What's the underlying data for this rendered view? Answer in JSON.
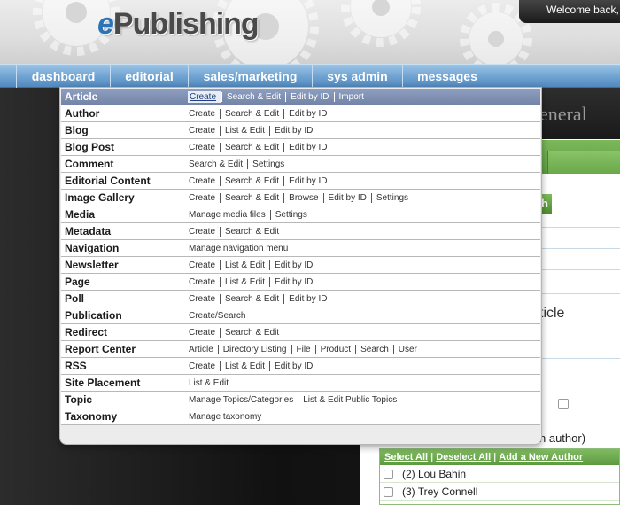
{
  "header": {
    "logo_prefix": "e",
    "logo_text": "Publishing",
    "welcome": "Welcome back,"
  },
  "nav": {
    "tabs": [
      "dashboard",
      "editorial",
      "sales/marketing",
      "sys admin",
      "messages"
    ]
  },
  "background_page": {
    "title_fragment": "eneral",
    "search_button_fragment": "h",
    "article_fragment": "ticle",
    "author_note_fragment": "n author)",
    "author_toolbar": {
      "select_all": "Select All",
      "deselect_all": "Deselect All",
      "add_author": "Add a New Author",
      "separator": "|"
    },
    "authors": [
      "(2) Lou Bahin",
      "(3) Trey Connell"
    ]
  },
  "menu": {
    "rows": [
      {
        "label": "Article",
        "actions": [
          "Create",
          "Search & Edit",
          "Edit by ID",
          "Import"
        ]
      },
      {
        "label": "Author",
        "actions": [
          "Create",
          "Search & Edit",
          "Edit by ID"
        ]
      },
      {
        "label": "Blog",
        "actions": [
          "Create",
          "List & Edit",
          "Edit by ID"
        ]
      },
      {
        "label": "Blog Post",
        "actions": [
          "Create",
          "Search & Edit",
          "Edit by ID"
        ]
      },
      {
        "label": "Comment",
        "actions": [
          "Search & Edit",
          "Settings"
        ]
      },
      {
        "label": "Editorial Content",
        "actions": [
          "Create",
          "Search & Edit",
          "Edit by ID"
        ]
      },
      {
        "label": "Image Gallery",
        "actions": [
          "Create",
          "Search & Edit",
          "Browse",
          "Edit by ID",
          "Settings"
        ]
      },
      {
        "label": "Media",
        "actions": [
          "Manage media files",
          "Settings"
        ]
      },
      {
        "label": "Metadata",
        "actions": [
          "Create",
          "Search & Edit"
        ]
      },
      {
        "label": "Navigation",
        "actions": [
          "Manage navigation menu"
        ]
      },
      {
        "label": "Newsletter",
        "actions": [
          "Create",
          "List & Edit",
          "Edit by ID"
        ]
      },
      {
        "label": "Page",
        "actions": [
          "Create",
          "List & Edit",
          "Edit by ID"
        ]
      },
      {
        "label": "Poll",
        "actions": [
          "Create",
          "Search & Edit",
          "Edit by ID"
        ]
      },
      {
        "label": "Publication",
        "actions": [
          "Create/Search"
        ]
      },
      {
        "label": "Redirect",
        "actions": [
          "Create",
          "Search & Edit"
        ]
      },
      {
        "label": "Report Center",
        "actions": [
          "Article",
          "Directory Listing",
          "File",
          "Product",
          "Search",
          "User"
        ]
      },
      {
        "label": "RSS",
        "actions": [
          "Create",
          "List & Edit",
          "Edit by ID"
        ]
      },
      {
        "label": "Site Placement",
        "actions": [
          "List & Edit"
        ]
      },
      {
        "label": "Topic",
        "actions": [
          "Manage Topics/Categories",
          "List & Edit Public Topics"
        ]
      },
      {
        "label": "Taxonomy",
        "actions": [
          "Manage taxonomy"
        ]
      }
    ]
  },
  "colors": {
    "nav_blue": "#6ea2d1",
    "menu_active": "#7c8cae",
    "accent_green": "#6aa84a",
    "logo_blue": "#2a74b8"
  }
}
